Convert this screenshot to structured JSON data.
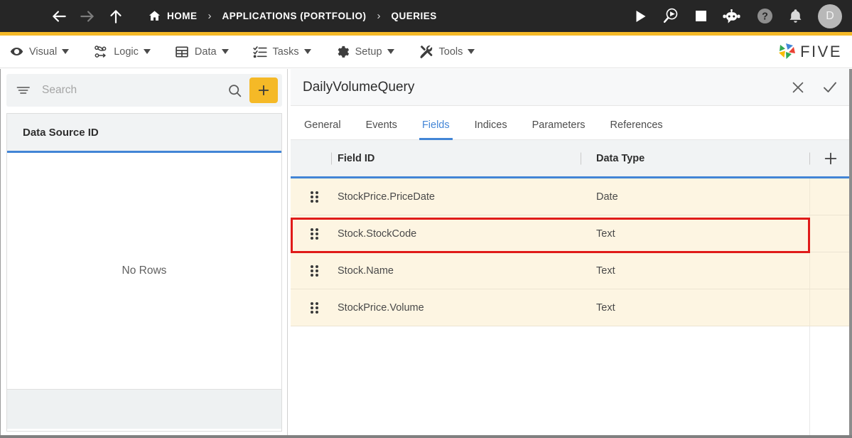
{
  "topbar": {
    "menu_icon": "hamburger-icon",
    "back_icon": "arrow-left-icon",
    "forward_icon": "arrow-right-icon",
    "up_icon": "arrow-up-icon",
    "breadcrumbs": [
      {
        "label": "HOME",
        "icon": "home-icon"
      },
      {
        "label": "APPLICATIONS (PORTFOLIO)"
      },
      {
        "label": "QUERIES"
      }
    ],
    "separator": "›",
    "actions": [
      {
        "name": "run-icon",
        "title": "Run"
      },
      {
        "name": "debug-icon",
        "title": "Debug"
      },
      {
        "name": "stop-icon",
        "title": "Stop"
      },
      {
        "name": "chatbot-icon",
        "title": "Assistant"
      },
      {
        "name": "help-icon",
        "title": "Help"
      },
      {
        "name": "notifications-icon",
        "title": "Notifications"
      }
    ],
    "avatar_initial": "D",
    "background": "#262626",
    "accent_rule": "#f5b927"
  },
  "menubar": {
    "items": [
      {
        "label": "Visual",
        "icon": "eye-icon"
      },
      {
        "label": "Logic",
        "icon": "logic-graph-icon"
      },
      {
        "label": "Data",
        "icon": "table-grid-icon"
      },
      {
        "label": "Tasks",
        "icon": "checklist-icon"
      },
      {
        "label": "Setup",
        "icon": "gear-icon"
      },
      {
        "label": "Tools",
        "icon": "tools-icon"
      }
    ],
    "logo_text": "FIVE",
    "logo_colors": [
      "#4285d6",
      "#ea4335",
      "#34a853",
      "#fbbc05"
    ]
  },
  "left_panel": {
    "search": {
      "placeholder": "Search",
      "value": "",
      "filter_icon": "filter-icon",
      "search_icon": "search-icon"
    },
    "add_button_label": "+",
    "add_button_color": "#f5b927",
    "list": {
      "header": "Data Source ID",
      "empty_message": "No Rows"
    }
  },
  "right_panel": {
    "title": "DailyVolumeQuery",
    "close_icon": "close-icon",
    "confirm_icon": "check-icon",
    "tabs": [
      {
        "label": "General",
        "active": false
      },
      {
        "label": "Events",
        "active": false
      },
      {
        "label": "Fields",
        "active": true
      },
      {
        "label": "Indices",
        "active": false
      },
      {
        "label": "Parameters",
        "active": false
      },
      {
        "label": "References",
        "active": false
      }
    ],
    "active_tab_color": "#4285d6",
    "grid": {
      "columns": [
        "Field ID",
        "Data Type"
      ],
      "add_column_icon": "plus-icon",
      "row_background": "#fdf5e2",
      "rows": [
        {
          "field_id": "StockPrice.PriceDate",
          "data_type": "Date",
          "highlighted": false
        },
        {
          "field_id": "Stock.StockCode",
          "data_type": "Text",
          "highlighted": true
        },
        {
          "field_id": "Stock.Name",
          "data_type": "Text",
          "highlighted": false
        },
        {
          "field_id": "StockPrice.Volume",
          "data_type": "Text",
          "highlighted": false
        }
      ]
    }
  },
  "annotation": {
    "type": "highlight-rectangle",
    "color": "#e01b19",
    "target_row": "Stock.StockCode"
  }
}
